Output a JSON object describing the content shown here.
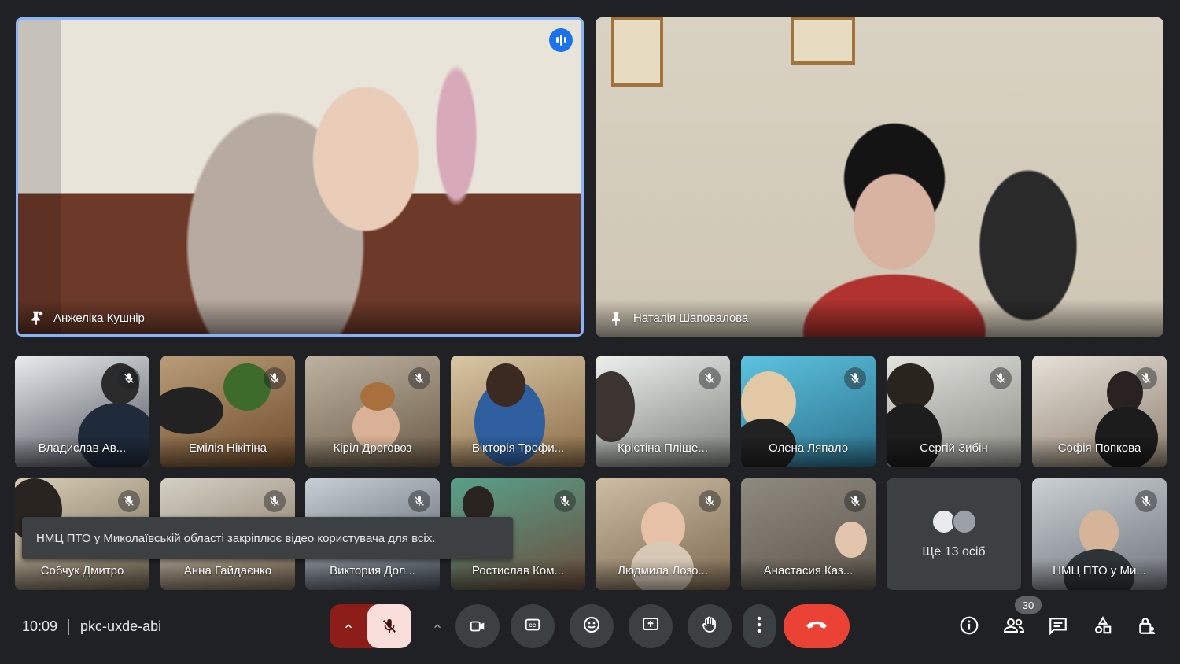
{
  "main_tiles": [
    {
      "name": "Анжеліка Кушнір"
    },
    {
      "name": "Наталія Шаповалова"
    }
  ],
  "grid_tiles": [
    {
      "name": "Владислав Ав...",
      "muted": true
    },
    {
      "name": "Емілія Нікітіна",
      "muted": true
    },
    {
      "name": "Кіріл Дроговоз",
      "muted": true
    },
    {
      "name": "Вікторія Трофи...",
      "muted": false
    },
    {
      "name": "Крістіна Пліще...",
      "muted": true
    },
    {
      "name": "Олена Ляпало",
      "muted": true
    },
    {
      "name": "Сергій Зибін",
      "muted": true
    },
    {
      "name": "Софія Попкова",
      "muted": true
    },
    {
      "name": "Собчук Дмитро",
      "muted": true
    },
    {
      "name": "Анна Гайдаєнко",
      "muted": true
    },
    {
      "name": "Виктория Дол...",
      "muted": true
    },
    {
      "name": "Ростислав Ком...",
      "muted": true
    },
    {
      "name": "Людмила Лозо...",
      "muted": true
    },
    {
      "name": "Анастасия Каз...",
      "muted": true
    },
    {
      "name": "НМЦ ПТО у Ми...",
      "muted": true
    }
  ],
  "more_tile": {
    "label": "Ще 13 осіб"
  },
  "toast": {
    "text": "НМЦ ПТО у Миколаївській області закріплює відео користувача для всіх."
  },
  "meeting": {
    "time": "10:09",
    "code": "pkc-uxde-abi"
  },
  "controls": {
    "mic": "mic-off-icon",
    "camera": "camera-icon",
    "captions": "captions-icon",
    "reactions": "emoji-icon",
    "present": "present-screen-icon",
    "raise_hand": "hand-icon",
    "more": "more-vert-icon",
    "hangup": "hangup-icon"
  },
  "right_controls": {
    "participants_count": "30"
  },
  "colors": {
    "background": "#202124",
    "active_speaker_border": "#8ab4f8",
    "hangup": "#ea4335",
    "mic_off_bg": "#8c1d18"
  }
}
